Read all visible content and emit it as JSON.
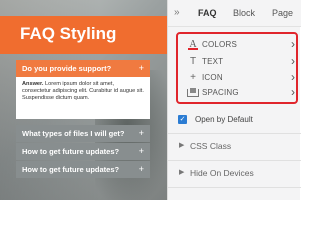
{
  "preview": {
    "title": "FAQ Styling",
    "questions": [
      {
        "text": "Do you provide support?",
        "expanded": true
      },
      {
        "text": "What types of files I will get?",
        "expanded": false
      },
      {
        "text": "How to get future updates?",
        "expanded": false
      },
      {
        "text": "How to get future updates?",
        "expanded": false
      }
    ],
    "answer_label": "Answer.",
    "answer_text": " Lorem ipsum dolor sit amet, consectetur adipiscing elit. Curabitur id augue sit. Suspendisse dictum quam.",
    "expand_glyph": "+",
    "accent_color": "#f06d2f",
    "collapsed_color": "#888e8f"
  },
  "panel": {
    "collapse_glyph": "»",
    "tabs": [
      {
        "label": "FAQ",
        "active": true
      },
      {
        "label": "Block",
        "active": false
      },
      {
        "label": "Page",
        "active": false
      }
    ],
    "style_options": [
      {
        "label": "COLORS",
        "icon": "text-color-icon",
        "glyph": "A"
      },
      {
        "label": "TEXT",
        "icon": "text-icon",
        "glyph": "T"
      },
      {
        "label": "ICON",
        "icon": "plus-icon",
        "glyph": "+"
      },
      {
        "label": "SPACING",
        "icon": "spacing-icon",
        "glyph": ""
      }
    ],
    "chevron_glyph": "›",
    "highlight_color": "#e0252c",
    "open_by_default": {
      "label": "Open by Default",
      "checked": true,
      "glyph": "✓"
    },
    "sections": [
      {
        "label": "CSS Class",
        "caret": "▶"
      },
      {
        "label": "Hide On Devices",
        "caret": "▶"
      }
    ]
  }
}
